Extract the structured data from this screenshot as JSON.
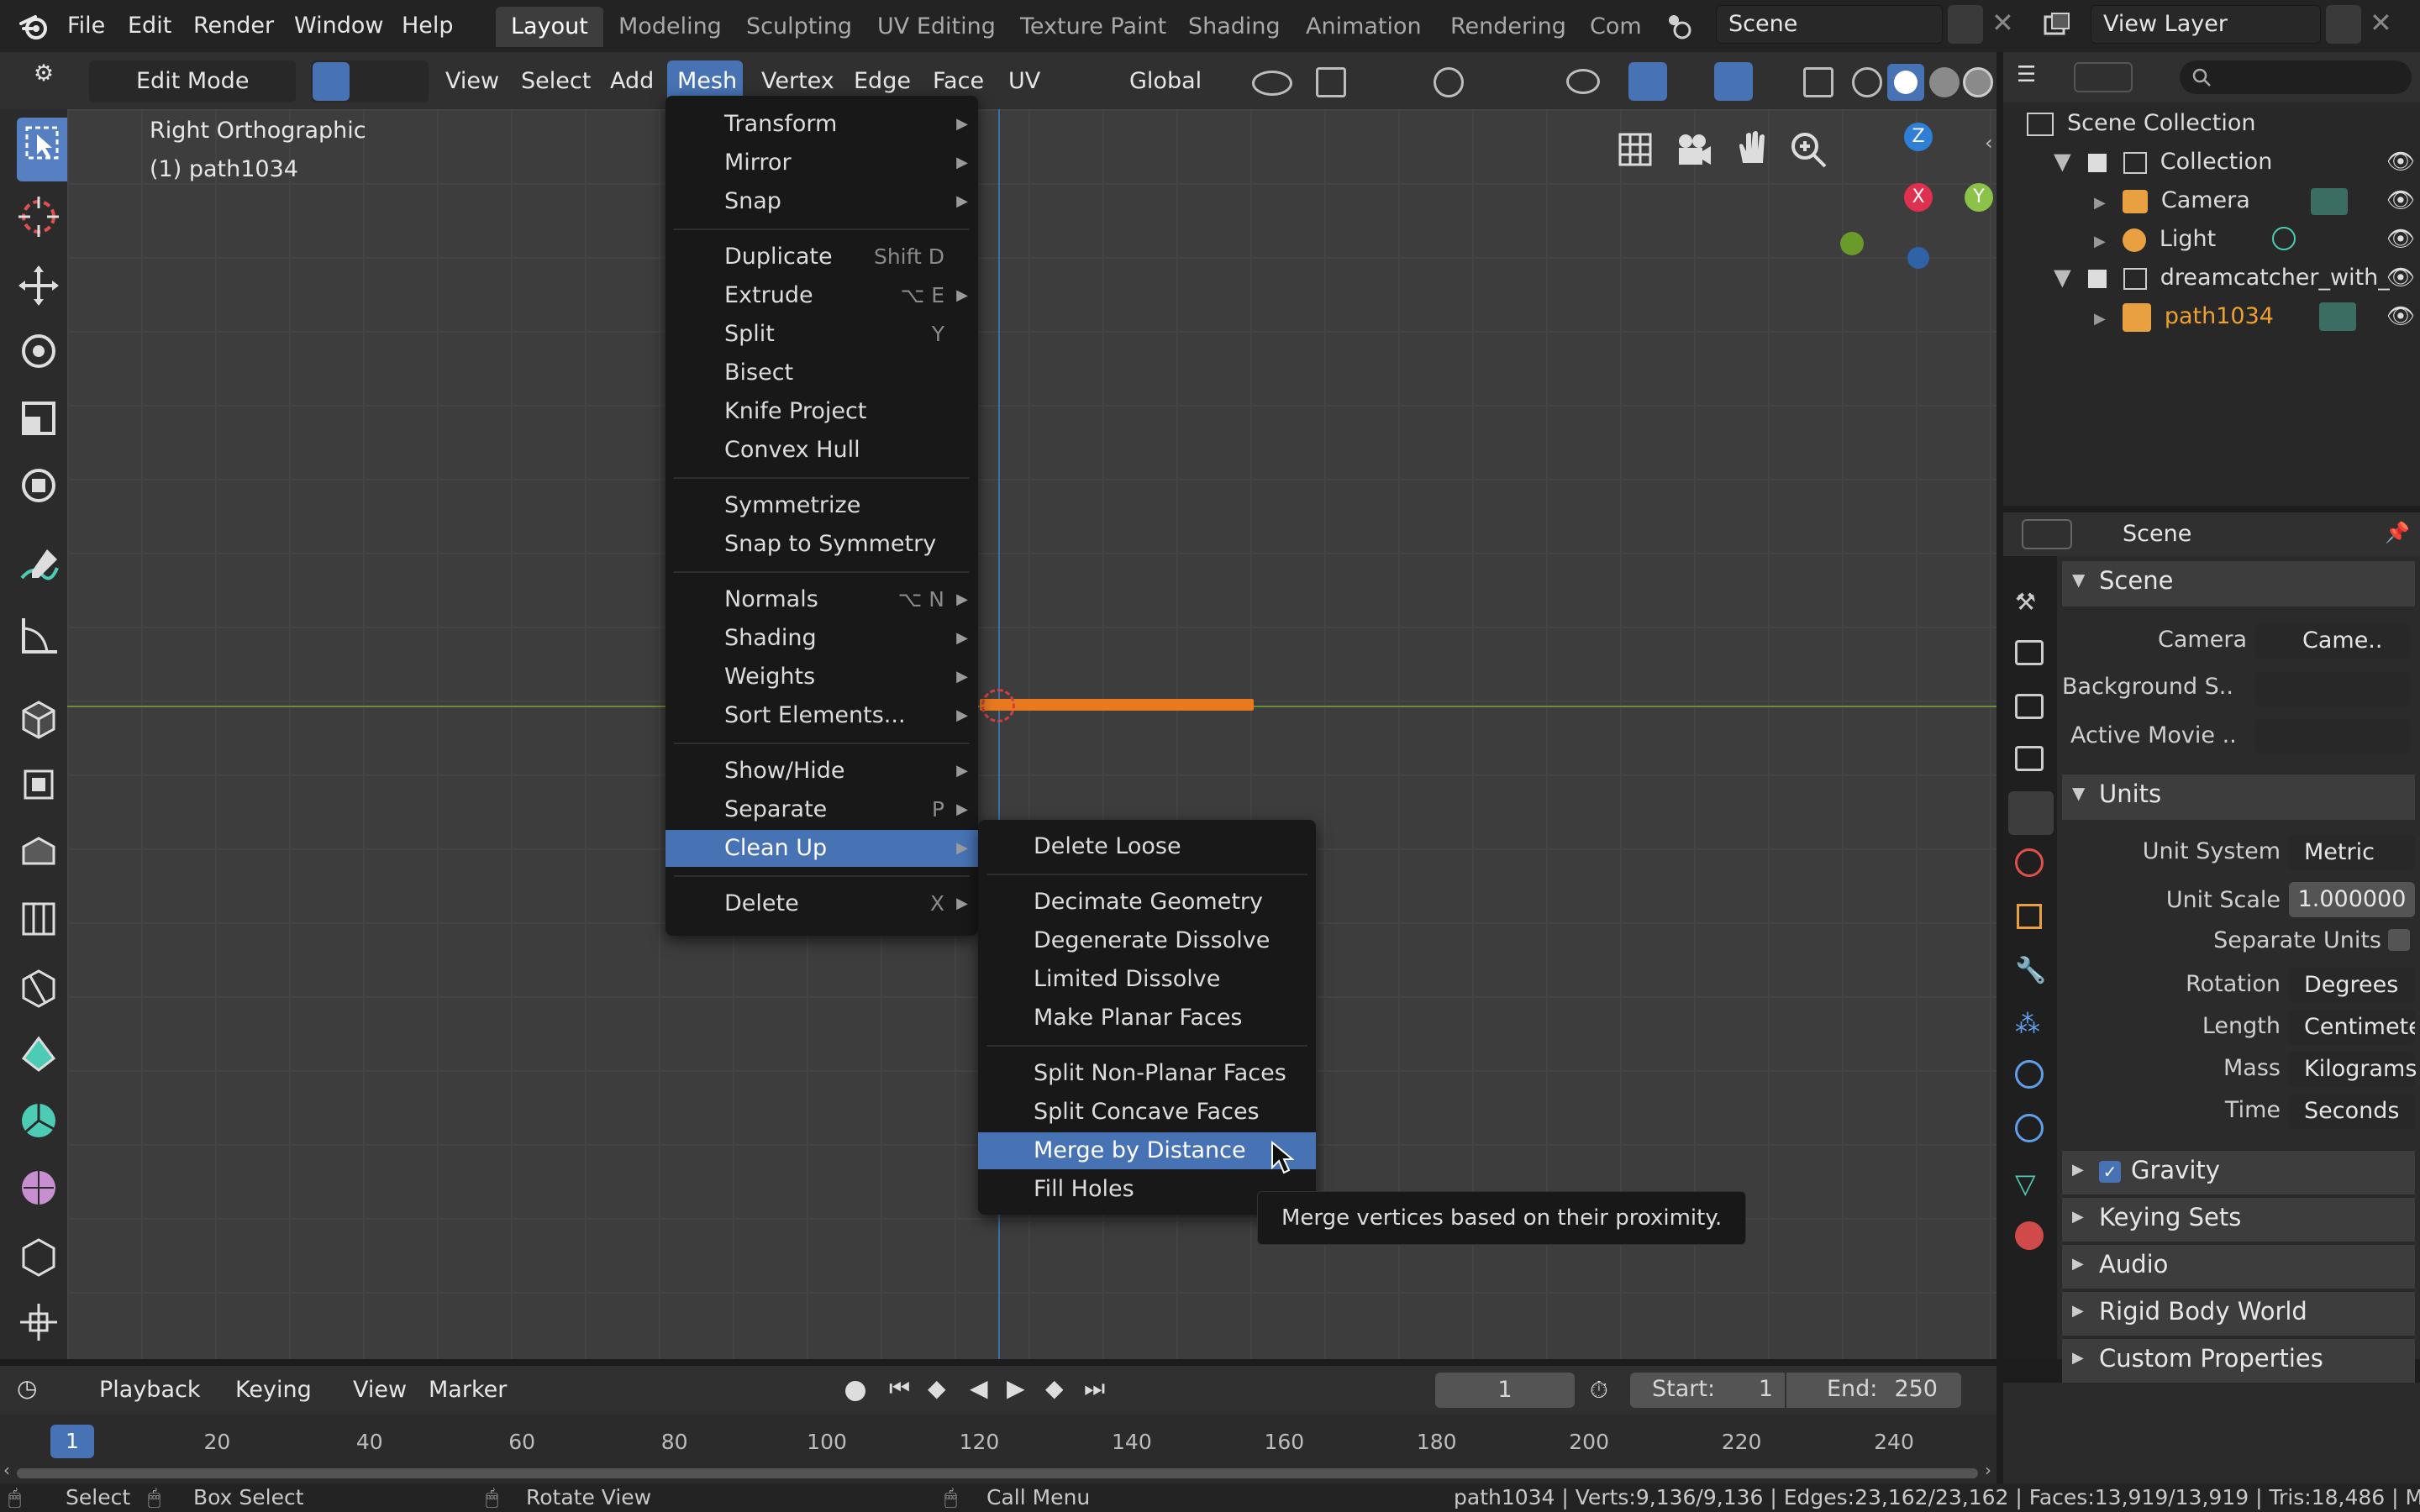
{
  "top_menu": [
    "File",
    "Edit",
    "Render",
    "Window",
    "Help"
  ],
  "workspace_tabs": [
    "Layout",
    "Modeling",
    "Sculpting",
    "UV Editing",
    "Texture Paint",
    "Shading",
    "Animation",
    "Rendering",
    "Com"
  ],
  "active_workspace": "Layout",
  "scene_field": "Scene",
  "view_layer_field": "View Layer",
  "viewport_header": {
    "mode": "Edit Mode",
    "menus": [
      "View",
      "Select",
      "Add",
      "Mesh",
      "Vertex",
      "Edge",
      "Face",
      "UV"
    ],
    "active_menu": "Mesh",
    "orientation": "Global"
  },
  "viewport": {
    "view_name": "Right Orthographic",
    "object_label": "(1) path1034",
    "gizmo_axes": [
      "Z",
      "X",
      "Y"
    ]
  },
  "mesh_menu": {
    "items": [
      {
        "label": "Transform",
        "shortcut": "",
        "submenu": true
      },
      {
        "label": "Mirror",
        "shortcut": "",
        "submenu": true
      },
      {
        "label": "Snap",
        "shortcut": "",
        "submenu": true
      },
      {
        "label": "Duplicate",
        "shortcut": "Shift D",
        "submenu": false
      },
      {
        "label": "Extrude",
        "shortcut": "⌥ E",
        "submenu": true
      },
      {
        "label": "Split",
        "shortcut": "Y",
        "submenu": false
      },
      {
        "label": "Bisect",
        "shortcut": "",
        "submenu": false
      },
      {
        "label": "Knife Project",
        "shortcut": "",
        "submenu": false
      },
      {
        "label": "Convex Hull",
        "shortcut": "",
        "submenu": false
      },
      {
        "label": "Symmetrize",
        "shortcut": "",
        "submenu": false
      },
      {
        "label": "Snap to Symmetry",
        "shortcut": "",
        "submenu": false
      },
      {
        "label": "Normals",
        "shortcut": "⌥ N",
        "submenu": true
      },
      {
        "label": "Shading",
        "shortcut": "",
        "submenu": true
      },
      {
        "label": "Weights",
        "shortcut": "",
        "submenu": true
      },
      {
        "label": "Sort Elements...",
        "shortcut": "",
        "submenu": true
      },
      {
        "label": "Show/Hide",
        "shortcut": "",
        "submenu": true
      },
      {
        "label": "Separate",
        "shortcut": "P",
        "submenu": true
      },
      {
        "label": "Clean Up",
        "shortcut": "",
        "submenu": true
      },
      {
        "label": "Delete",
        "shortcut": "X",
        "submenu": true
      }
    ],
    "highlighted": "Clean Up"
  },
  "cleanup_menu": {
    "items": [
      "Delete Loose",
      "Decimate Geometry",
      "Degenerate Dissolve",
      "Limited Dissolve",
      "Make Planar Faces",
      "Split Non-Planar Faces",
      "Split Concave Faces",
      "Merge by Distance",
      "Fill Holes"
    ],
    "highlighted": "Merge by Distance"
  },
  "tooltip": "Merge vertices based on their proximity.",
  "outliner": {
    "root": "Scene Collection",
    "rows": [
      "Collection",
      "Camera",
      "Light",
      "dreamcatcher_with_",
      "path1034"
    ]
  },
  "properties": {
    "context": "Scene",
    "scene_section": "Scene",
    "camera_label": "Camera",
    "camera_value": "Came..",
    "background_label": "Background S..",
    "active_movie_label": "Active Movie ..",
    "units_section": "Units",
    "unit_system_label": "Unit System",
    "unit_system": "Metric",
    "unit_scale_label": "Unit Scale",
    "unit_scale": "1.000000",
    "separate_units_label": "Separate Units",
    "rotation_label": "Rotation",
    "rotation": "Degrees",
    "length_label": "Length",
    "length": "Centimeters",
    "mass_label": "Mass",
    "mass": "Kilograms",
    "time_label": "Time",
    "time": "Seconds",
    "collapsed_sections": [
      "Gravity",
      "Keying Sets",
      "Audio",
      "Rigid Body World",
      "Custom Properties"
    ]
  },
  "timeline": {
    "menus": [
      "Playback",
      "Keying",
      "View",
      "Marker"
    ],
    "current_frame": "1",
    "start_label": "Start:",
    "start": "1",
    "end_label": "End:",
    "end": "250",
    "ruler": [
      "1",
      "20",
      "40",
      "60",
      "80",
      "100",
      "120",
      "140",
      "160",
      "180",
      "200",
      "220",
      "240"
    ]
  },
  "statusbar": {
    "select": "Select",
    "box_select": "Box Select",
    "rotate_view": "Rotate View",
    "call_menu": "Call Menu",
    "stats": "path1034 | Verts:9,136/9,136 | Edges:23,162/23,162 | Faces:13,919/13,919 | Tris:18,486 | Mem:"
  }
}
